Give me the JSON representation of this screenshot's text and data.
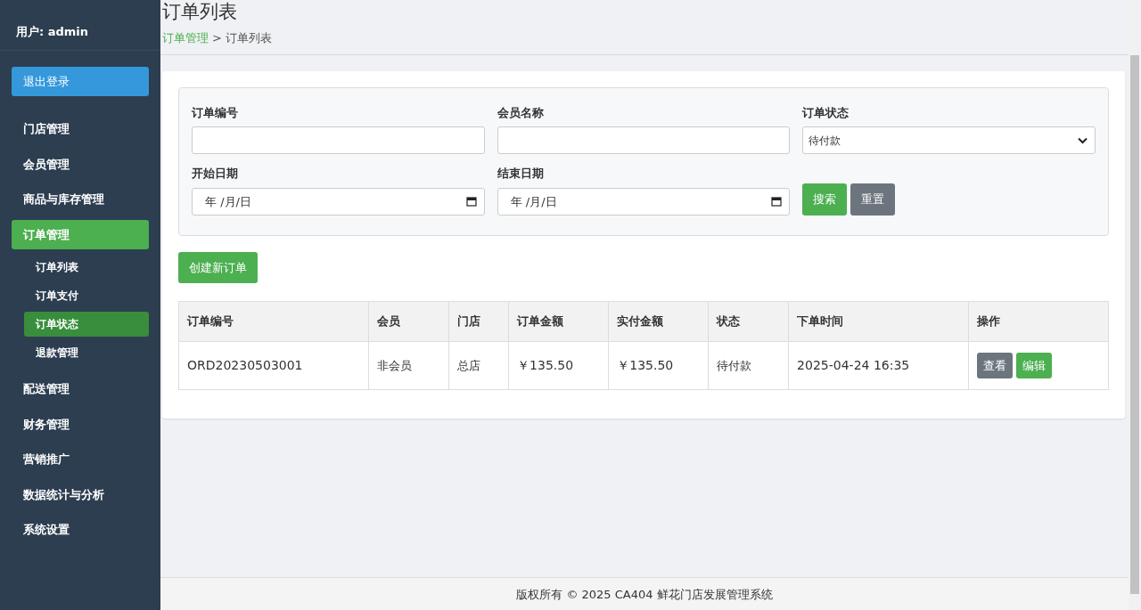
{
  "sidebar": {
    "user": "用户: admin",
    "logout": "退出登录",
    "items": [
      {
        "label": "门店管理",
        "selected": false
      },
      {
        "label": "会员管理",
        "selected": false
      },
      {
        "label": "商品与库存管理",
        "selected": false
      },
      {
        "label": "订单管理",
        "selected": true,
        "children": [
          {
            "label": "订单列表",
            "selected": false
          },
          {
            "label": "订单支付",
            "selected": false
          },
          {
            "label": "订单状态",
            "selected": true
          },
          {
            "label": "退款管理",
            "selected": false
          }
        ]
      },
      {
        "label": "配送管理",
        "selected": false
      },
      {
        "label": "财务管理",
        "selected": false
      },
      {
        "label": "营销推广",
        "selected": false
      },
      {
        "label": "数据统计与分析",
        "selected": false
      },
      {
        "label": "系统设置",
        "selected": false
      }
    ]
  },
  "page": {
    "title": "订单列表",
    "breadcrumb": [
      {
        "label": "订单管理",
        "kind": "link"
      },
      {
        "label": ">",
        "kind": "separator"
      },
      {
        "label": "订单列表",
        "kind": "current"
      }
    ]
  },
  "filters": [
    {
      "label": "订单编号",
      "kind": "text"
    },
    {
      "label": "会员名称",
      "kind": "text"
    },
    {
      "label": "订单状态",
      "kind": "select",
      "value": "待付款"
    },
    {
      "label": "开始日期",
      "kind": "date",
      "value": "年 /月/日"
    },
    {
      "label": "结束日期",
      "kind": "date",
      "value": "年 /月/日"
    }
  ],
  "filter_buttons": [
    {
      "label": "搜索",
      "kind": "primary"
    },
    {
      "label": "重置",
      "kind": "secondary"
    }
  ],
  "create_button": "创建新订单",
  "table": {
    "columns": [
      "订单编号",
      "会员",
      "门店",
      "订单金额",
      "实付金额",
      "状态",
      "下单时间",
      "操作"
    ],
    "rows": [
      {
        "cells": [
          "ORD20230503001",
          "非会员",
          "总店",
          "￥135.50",
          "￥135.50",
          "待付款",
          "2025-04-24 16:35"
        ],
        "actions": [
          {
            "label": "查看",
            "kind": "secondary"
          },
          {
            "label": "编辑",
            "kind": "primary"
          }
        ]
      }
    ]
  },
  "footer": "版权所有 © 2025 CA404 鲜花门店发展管理系统"
}
